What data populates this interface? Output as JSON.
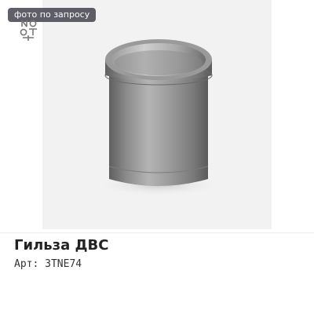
{
  "photo_badge": "фото по запросу",
  "product": {
    "title": "Гильза ДВС",
    "sku_label": "Арт:",
    "sku_value": "3TNE74"
  },
  "icons": {
    "brand_logo": "brand-logo-icon"
  },
  "colors": {
    "badge_bg": "#3c3c46",
    "photo_bg": "#f2f2f2",
    "metal": "#8a8a8a"
  }
}
